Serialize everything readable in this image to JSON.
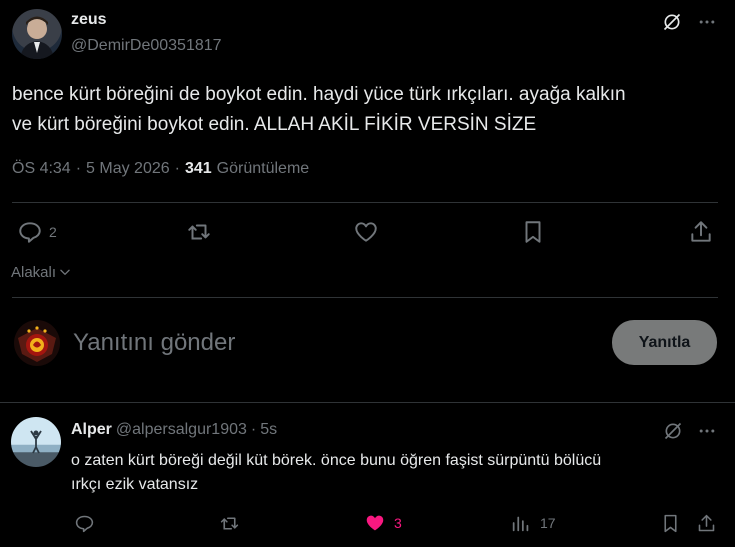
{
  "post": {
    "author_name": "zeus",
    "author_handle": "@DemirDe00351817",
    "text_line1": "bence kürt böreğini de boykot edin. haydi yüce türk ırkçıları. ayağa kalkın",
    "text_line2": "ve kürt böreğini boykot edin. ALLAH AKİL FİKİR VERSİN SİZE",
    "time": "ÖS 4:34",
    "sep1": "·",
    "date": "5 May 2026",
    "sep2": "·",
    "views": "341",
    "views_label": "Görüntüleme",
    "reply_count": "2",
    "icons": [
      "grok-icon",
      "more-icon",
      "reply-icon",
      "retweet-icon",
      "like-icon",
      "bookmark-icon",
      "share-icon"
    ]
  },
  "sort": {
    "label": "Alakalı"
  },
  "composer": {
    "placeholder": "Yanıtını gönder",
    "button_label": "Yanıtla"
  },
  "reply": {
    "author_name": "Alper",
    "author_handle": "@alpersalgur1903",
    "sep": "·",
    "age": "5s",
    "text_line1": "o zaten kürt böreği değil küt börek. önce bunu öğren faşist sürpüntü bölücü",
    "text_line2": "ırkçı ezik vatansız",
    "like_count": "3",
    "view_count": "17"
  },
  "colors": {
    "background": "#000000",
    "text": "#e7e9ea",
    "muted": "#71767b",
    "like_active": "#f91880",
    "divider": "#2f3336"
  }
}
